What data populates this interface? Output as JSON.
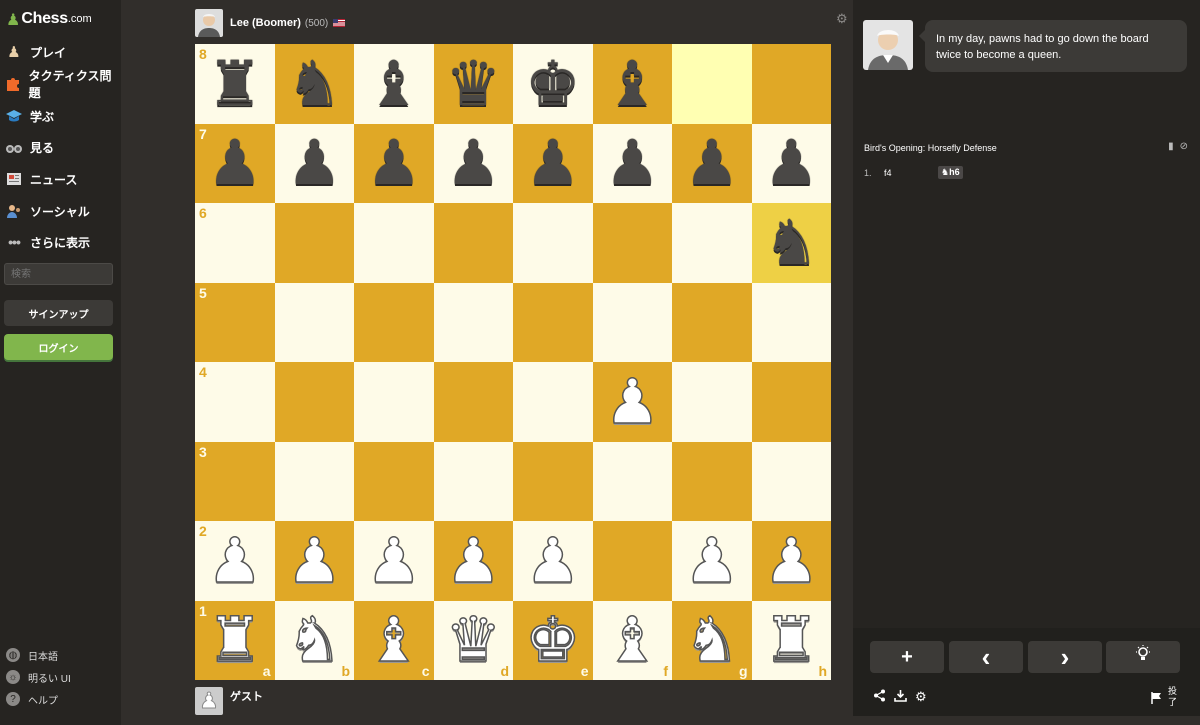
{
  "brand": {
    "name": "Chess",
    "suffix": ".com"
  },
  "nav": [
    {
      "label": "プレイ",
      "icon": "play-pawn-icon"
    },
    {
      "label": "タクティクス問題",
      "icon": "puzzle-icon"
    },
    {
      "label": "学ぶ",
      "icon": "graduation-cap-icon"
    },
    {
      "label": "見る",
      "icon": "binoculars-icon"
    },
    {
      "label": "ニュース",
      "icon": "newspaper-icon"
    },
    {
      "label": "ソーシャル",
      "icon": "social-icon"
    },
    {
      "label": "さらに表示",
      "icon": "more-dots-icon"
    }
  ],
  "search": {
    "placeholder": "検索"
  },
  "auth": {
    "signup": "サインアップ",
    "login": "ログイン"
  },
  "footer": {
    "language": "日本語",
    "theme": "明るい UI",
    "help": "ヘルプ"
  },
  "opponent": {
    "name": "Lee (Boomer)",
    "rating": "(500)"
  },
  "player": {
    "name": "ゲスト"
  },
  "board": {
    "ranks": [
      "8",
      "7",
      "6",
      "5",
      "4",
      "3",
      "2",
      "1"
    ],
    "files": [
      "a",
      "b",
      "c",
      "d",
      "e",
      "f",
      "g",
      "h"
    ],
    "position": [
      [
        "br",
        "bn",
        "bb",
        "bq",
        "bk",
        "bb",
        "",
        ""
      ],
      [
        "bp",
        "bp",
        "bp",
        "bp",
        "bp",
        "bp",
        "bp",
        "bp"
      ],
      [
        "",
        "",
        "",
        "",
        "",
        "",
        "",
        "bn"
      ],
      [
        "",
        "",
        "",
        "",
        "",
        "",
        "",
        ""
      ],
      [
        "",
        "",
        "",
        "",
        "",
        "wp",
        "",
        ""
      ],
      [
        "",
        "",
        "",
        "",
        "",
        "",
        "",
        ""
      ],
      [
        "wp",
        "wp",
        "wp",
        "wp",
        "wp",
        "",
        "wp",
        "wp"
      ],
      [
        "wr",
        "wn",
        "wb",
        "wq",
        "wk",
        "wb",
        "wn",
        "wr"
      ]
    ],
    "highlights": [
      "g8",
      "h6"
    ],
    "colors": {
      "light": "#fefbe8",
      "dark": "#e0a826",
      "highlight": "#ffffb2"
    }
  },
  "coach": {
    "message": "In my day, pawns had to go down the board twice to become a queen."
  },
  "opening": {
    "name": "Bird's Opening: Horsefly Defense"
  },
  "moves": [
    {
      "num": "1.",
      "white": "f4",
      "black": "h6",
      "black_piece": "♞"
    }
  ],
  "controls": {
    "add": "+",
    "prev": "‹",
    "next": "›",
    "hint": "hint-bulb-icon"
  },
  "resign": {
    "label": "投了"
  }
}
